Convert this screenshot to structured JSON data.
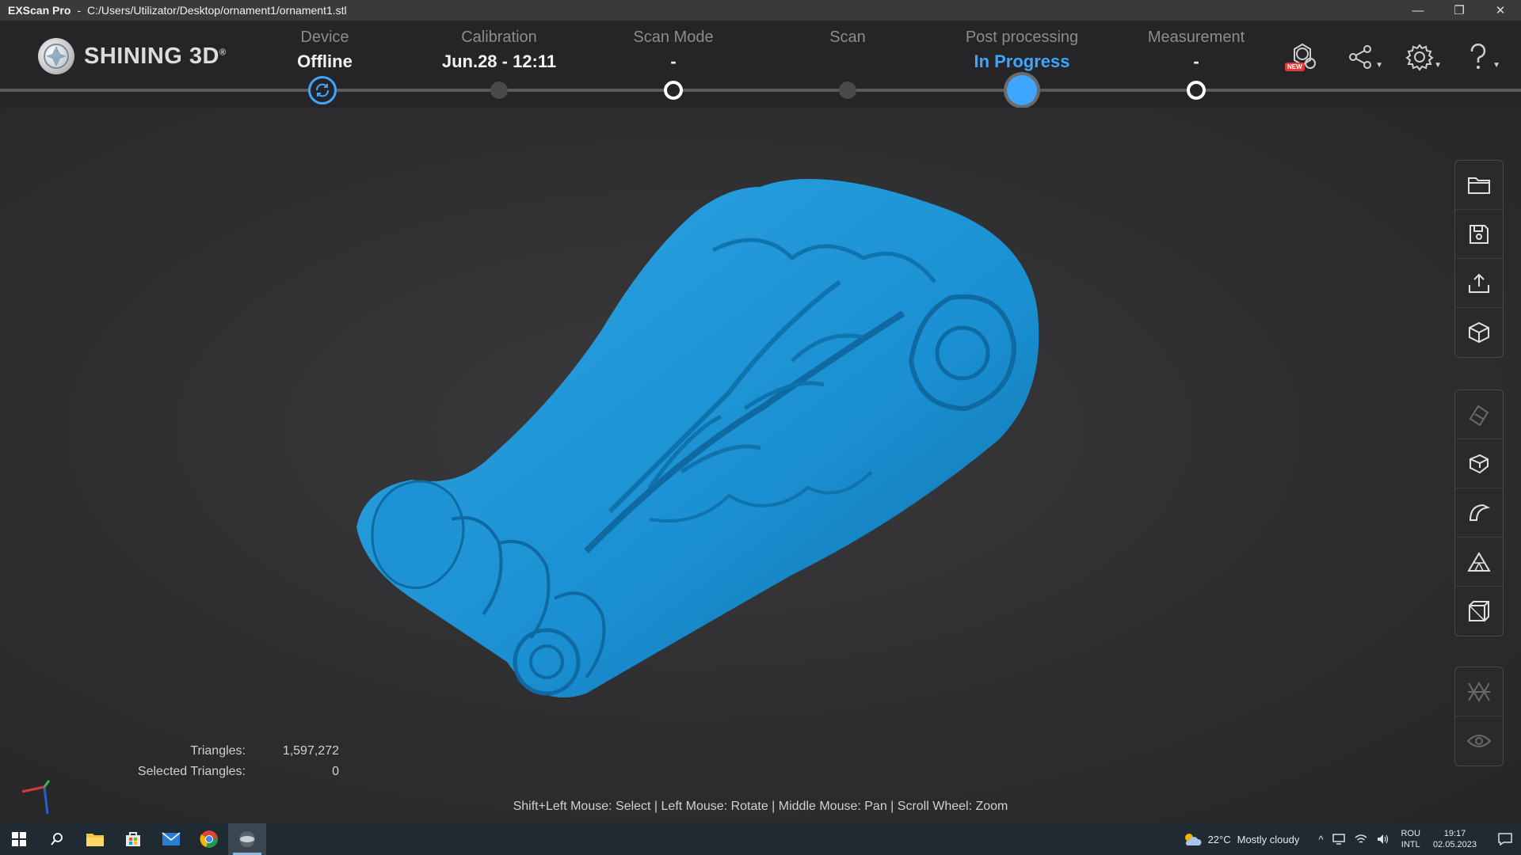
{
  "window": {
    "app_name": "EXScan Pro",
    "separator": "-",
    "file_path": "C:/Users/Utilizator/Desktop/ornament1/ornament1.stl",
    "minimize": "—",
    "restore": "❐",
    "close": "✕"
  },
  "brand": {
    "name": "SHINING 3D",
    "reg": "®"
  },
  "steps": [
    {
      "label": "Device",
      "value": "Offline"
    },
    {
      "label": "Calibration",
      "value": "Jun.28 - 12:11"
    },
    {
      "label": "Scan Mode",
      "value": "-"
    },
    {
      "label": "Scan",
      "value": ""
    },
    {
      "label": "Post processing",
      "value": "In Progress"
    },
    {
      "label": "Measurement",
      "value": "-"
    }
  ],
  "header_icons": {
    "new_badge": "NEW",
    "items": [
      "model-update-icon",
      "share-icon",
      "settings-icon",
      "help-icon"
    ]
  },
  "stats": {
    "triangles_label": "Triangles:",
    "triangles_value": "1,597,272",
    "selected_label": "Selected Triangles:",
    "selected_value": "0"
  },
  "hint": "Shift+Left Mouse: Select | Left Mouse: Rotate | Middle Mouse: Pan | Scroll Wheel: Zoom",
  "toolbar_groups": [
    [
      "open-folder-icon",
      "save-icon",
      "export-icon",
      "cube-view-icon"
    ],
    [
      "edit-disabled-icon",
      "fill-holes-icon",
      "smooth-icon",
      "simplify-icon",
      "bounding-box-icon"
    ],
    [
      "mirror-icon",
      "visibility-icon"
    ]
  ],
  "colors": {
    "accent": "#3ea6ff",
    "model": "#1a8fd1",
    "background": "#2e2e30"
  },
  "taskbar": {
    "weather_temp": "22°C",
    "weather_text": "Mostly cloudy",
    "lang_top": "ROU",
    "lang_bottom": "INTL",
    "time": "19:17",
    "date": "02.05.2023"
  }
}
